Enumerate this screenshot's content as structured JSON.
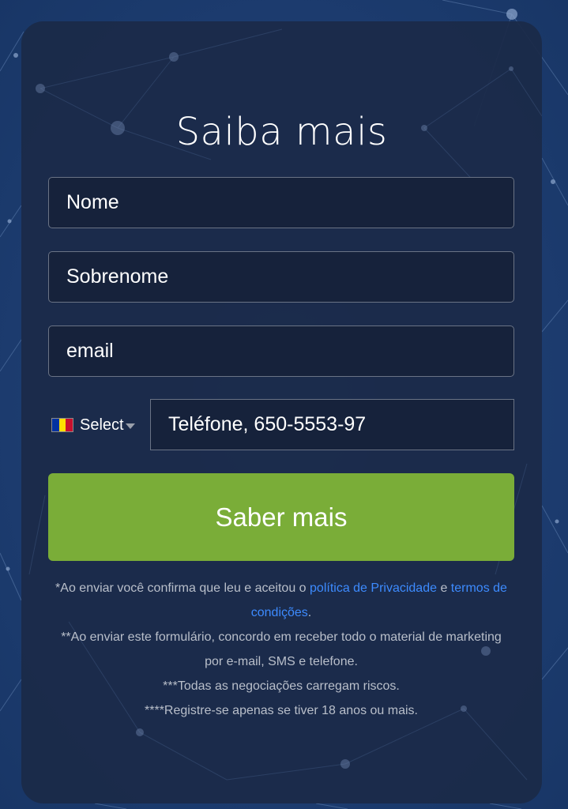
{
  "form": {
    "title": "Saiba mais",
    "fields": {
      "first_name_placeholder": "Nome",
      "last_name_placeholder": "Sobrenome",
      "email_placeholder": "email",
      "phone_placeholder": "Teléfone, 650-5553-97"
    },
    "country_select": {
      "label": "Select",
      "flag_colors": [
        "#0032a0",
        "#fedf00",
        "#c8102e"
      ]
    },
    "submit_label": "Saber mais",
    "disclaimer": {
      "line1_prefix": "*Ao enviar você confirma que leu e aceitou o ",
      "privacy_link": "política de Privacidade",
      "line1_mid": " e ",
      "terms_link": "termos de condições",
      "line1_suffix": ".",
      "line2": "**Ao enviar este formulário, concordo em receber todo o material de marketing por e-mail, SMS e telefone.",
      "line3": "***Todas as negociações carregam riscos.",
      "line4": "****Registre-se apenas se tiver 18 anos ou mais."
    }
  },
  "colors": {
    "accent_button": "#7aad38",
    "link": "#3d8bff",
    "card_bg": "#1b2a48",
    "page_bg": "#1d3a6e"
  }
}
